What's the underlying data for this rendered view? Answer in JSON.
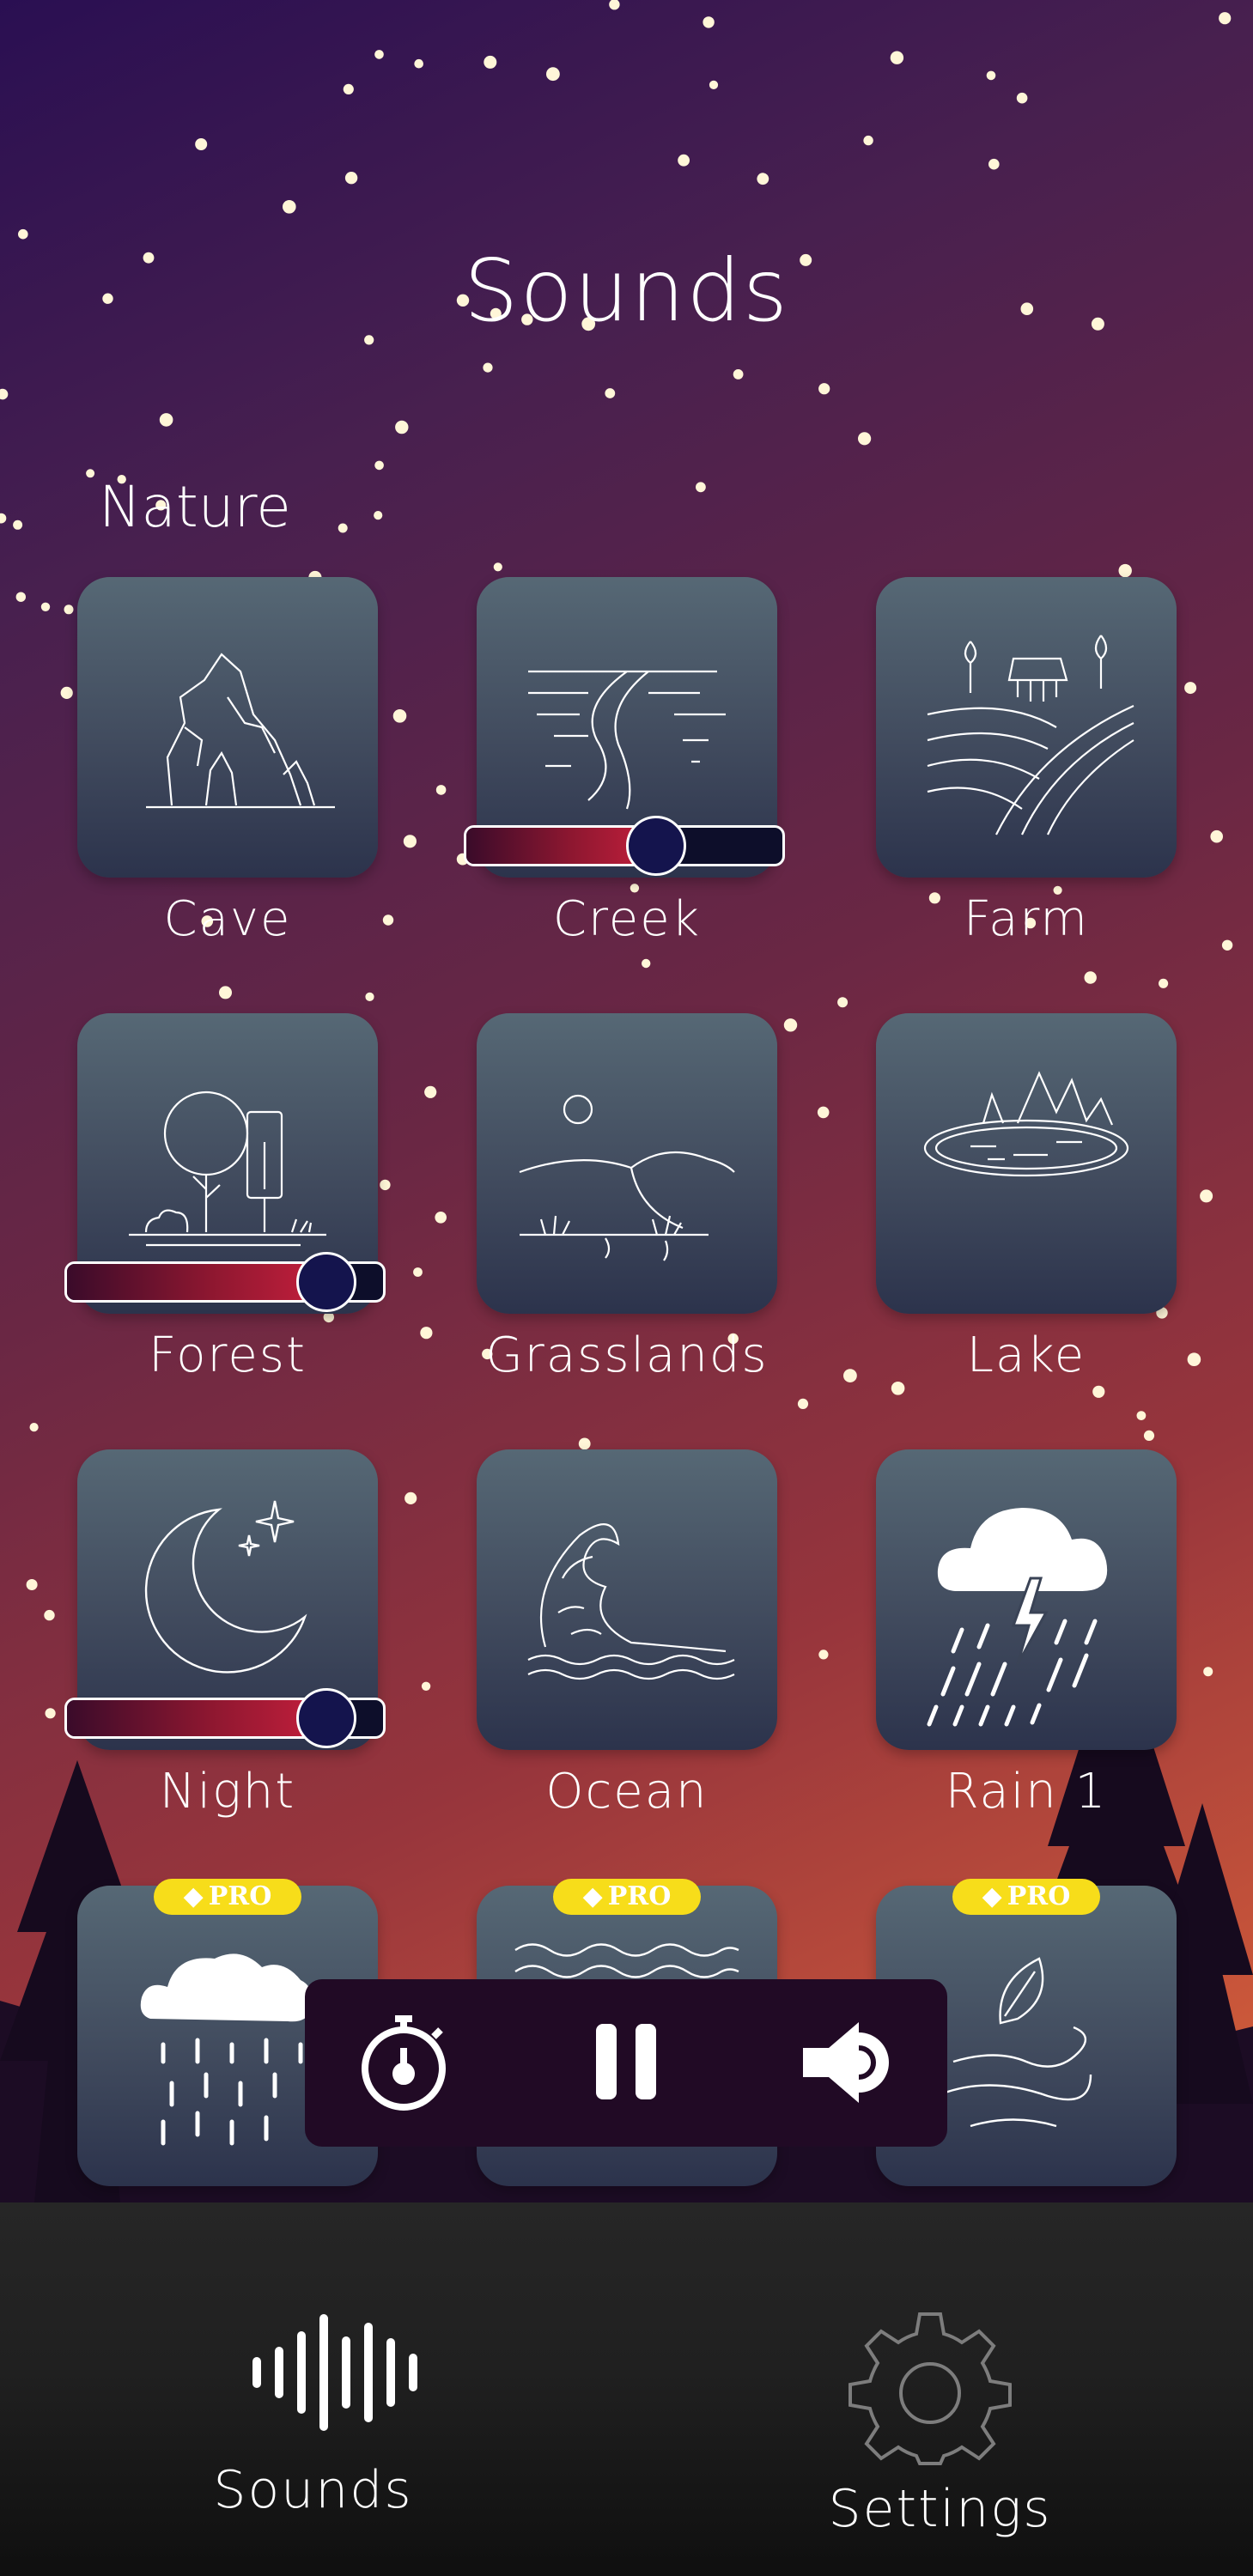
{
  "header": {
    "title": "Sounds"
  },
  "section": {
    "label": "Nature"
  },
  "tiles": [
    {
      "label": "Cave",
      "icon": "cave-icon"
    },
    {
      "label": "Creek",
      "icon": "creek-icon",
      "volume": 0.6
    },
    {
      "label": "Farm",
      "icon": "farm-icon"
    },
    {
      "label": "Forest",
      "icon": "forest-icon",
      "volume": 0.82
    },
    {
      "label": "Grasslands",
      "icon": "grasslands-icon"
    },
    {
      "label": "Lake",
      "icon": "lake-icon"
    },
    {
      "label": "Night",
      "icon": "night-icon",
      "volume": 0.82
    },
    {
      "label": "Ocean",
      "icon": "ocean-icon"
    },
    {
      "label": "Rain 1",
      "icon": "rain-lightning-icon"
    },
    {
      "label": "",
      "icon": "heavy-rain-icon",
      "pro": "PRO"
    },
    {
      "label": "",
      "icon": "waves-icon",
      "pro": "PRO"
    },
    {
      "label": "",
      "icon": "wind-leaf-icon",
      "pro": "PRO"
    }
  ],
  "player": {
    "timer_icon": "stopwatch-icon",
    "pause_icon": "pause-icon",
    "volume_icon": "speaker-icon"
  },
  "tabbar": {
    "sounds_label": "Sounds",
    "settings_label": "Settings",
    "sounds_icon": "sound-wave-icon",
    "settings_icon": "gear-icon"
  },
  "colors": {
    "pro_badge": "#f7dd1a",
    "slider_fill": "#c51f3c",
    "knob": "#14144d",
    "player_bg": "#210a25"
  }
}
